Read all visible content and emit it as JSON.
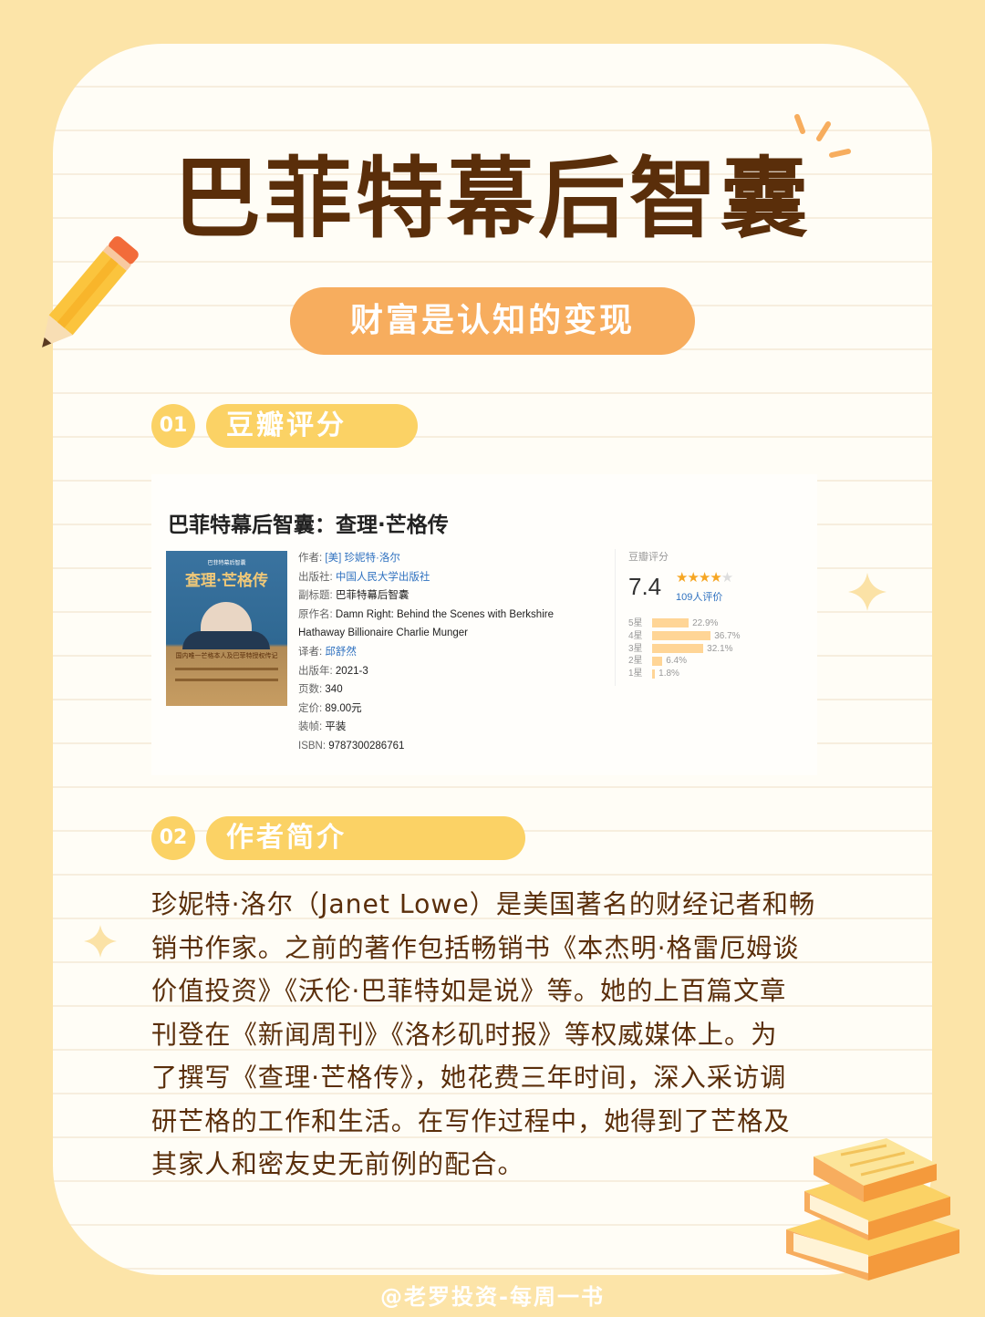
{
  "main_title": "巴菲特幕后智囊",
  "subtitle": "财富是认知的变现",
  "sections": [
    {
      "num": "01",
      "label": "豆瓣评分"
    },
    {
      "num": "02",
      "label": "作者简介"
    }
  ],
  "book": {
    "title": "巴菲特幕后智囊：查理·芒格传",
    "cover": {
      "small_text": "巴菲特幕后智囊",
      "title": "查理·芒格传",
      "tagline": "国内唯一芒格本人及巴菲特授权传记"
    },
    "meta": [
      {
        "key": "作者:",
        "value": "[美] 珍妮特·洛尔",
        "link": true
      },
      {
        "key": "出版社:",
        "value": "中国人民大学出版社",
        "link": true
      },
      {
        "key": "副标题:",
        "value": "巴菲特幕后智囊",
        "link": false
      },
      {
        "key": "原作名:",
        "value": "Damn Right: Behind the Scenes with Berkshire",
        "link": false
      },
      {
        "key": "",
        "value": "Hathaway Billionaire Charlie Munger",
        "link": false
      },
      {
        "key": "译者:",
        "value": "邱舒然",
        "link": true
      },
      {
        "key": "出版年:",
        "value": "2021-3",
        "link": false
      },
      {
        "key": "页数:",
        "value": "340",
        "link": false
      },
      {
        "key": "定价:",
        "value": "89.00元",
        "link": false
      },
      {
        "key": "装帧:",
        "value": "平装",
        "link": false
      },
      {
        "key": "ISBN:",
        "value": "9787300286761",
        "link": false
      }
    ]
  },
  "rating": {
    "label": "豆瓣评分",
    "score": "7.4",
    "stars_full": 3.5,
    "count": "109人评价",
    "distribution": [
      {
        "label": "5星",
        "percent": 22.9,
        "text": "22.9%"
      },
      {
        "label": "4星",
        "percent": 36.7,
        "text": "36.7%"
      },
      {
        "label": "3星",
        "percent": 32.1,
        "text": "32.1%"
      },
      {
        "label": "2星",
        "percent": 6.4,
        "text": "6.4%"
      },
      {
        "label": "1星",
        "percent": 1.8,
        "text": "1.8%"
      }
    ]
  },
  "author_intro": [
    "珍妮特·洛尔（Janet Lowe）是美国著名的财经记者和畅",
    "销书作家。之前的著作包括畅销书《本杰明·格雷厄姆谈",
    "价值投资》《沃伦·巴菲特如是说》等。她的上百篇文章",
    "刊登在《新闻周刊》《洛杉矶时报》等权威媒体上。为",
    "了撰写《查理·芒格传》，她花费三年时间，深入采访调",
    "研芒格的工作和生活。在写作过程中，她得到了芒格及",
    "其家人和密友史无前例的配合。"
  ],
  "footer": "@老罗投资-每周一书",
  "colors": {
    "background": "#fce4a8",
    "title": "#5a2e0a",
    "accent_orange": "#f7ad5e",
    "accent_yellow": "#fbd265"
  }
}
